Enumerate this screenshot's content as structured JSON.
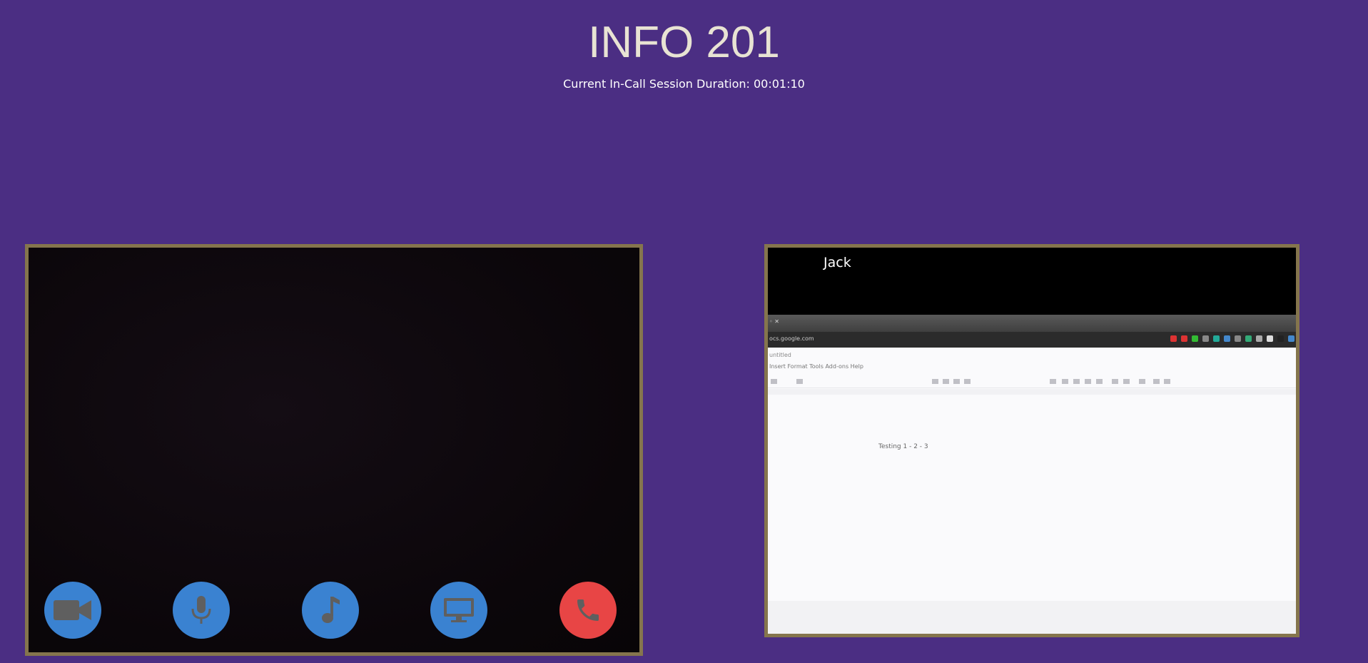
{
  "header": {
    "title": "INFO 201",
    "session_duration": "Current In-Call Session Duration: 00:01:10"
  },
  "local_video": {
    "controls": [
      {
        "name": "video-camera",
        "icon": "video-camera-icon"
      },
      {
        "name": "microphone",
        "icon": "microphone-icon"
      },
      {
        "name": "music",
        "icon": "music-note-icon"
      },
      {
        "name": "screen-share",
        "icon": "monitor-icon"
      },
      {
        "name": "end-call",
        "icon": "phone-hangup-icon"
      }
    ]
  },
  "remote_video": {
    "participant_name": "Jack",
    "shared_screen": {
      "url": "ocs.google.com",
      "menu": "untitled",
      "menu_items": "Insert  Format  Tools  Add-ons  Help",
      "document_text": "Testing 1 - 2 - 3"
    }
  },
  "colors": {
    "background": "#4b2e83",
    "title": "#e8e3d3",
    "border": "#85754d",
    "control_button": "#3a82d1",
    "end_call_button": "#e84545"
  }
}
